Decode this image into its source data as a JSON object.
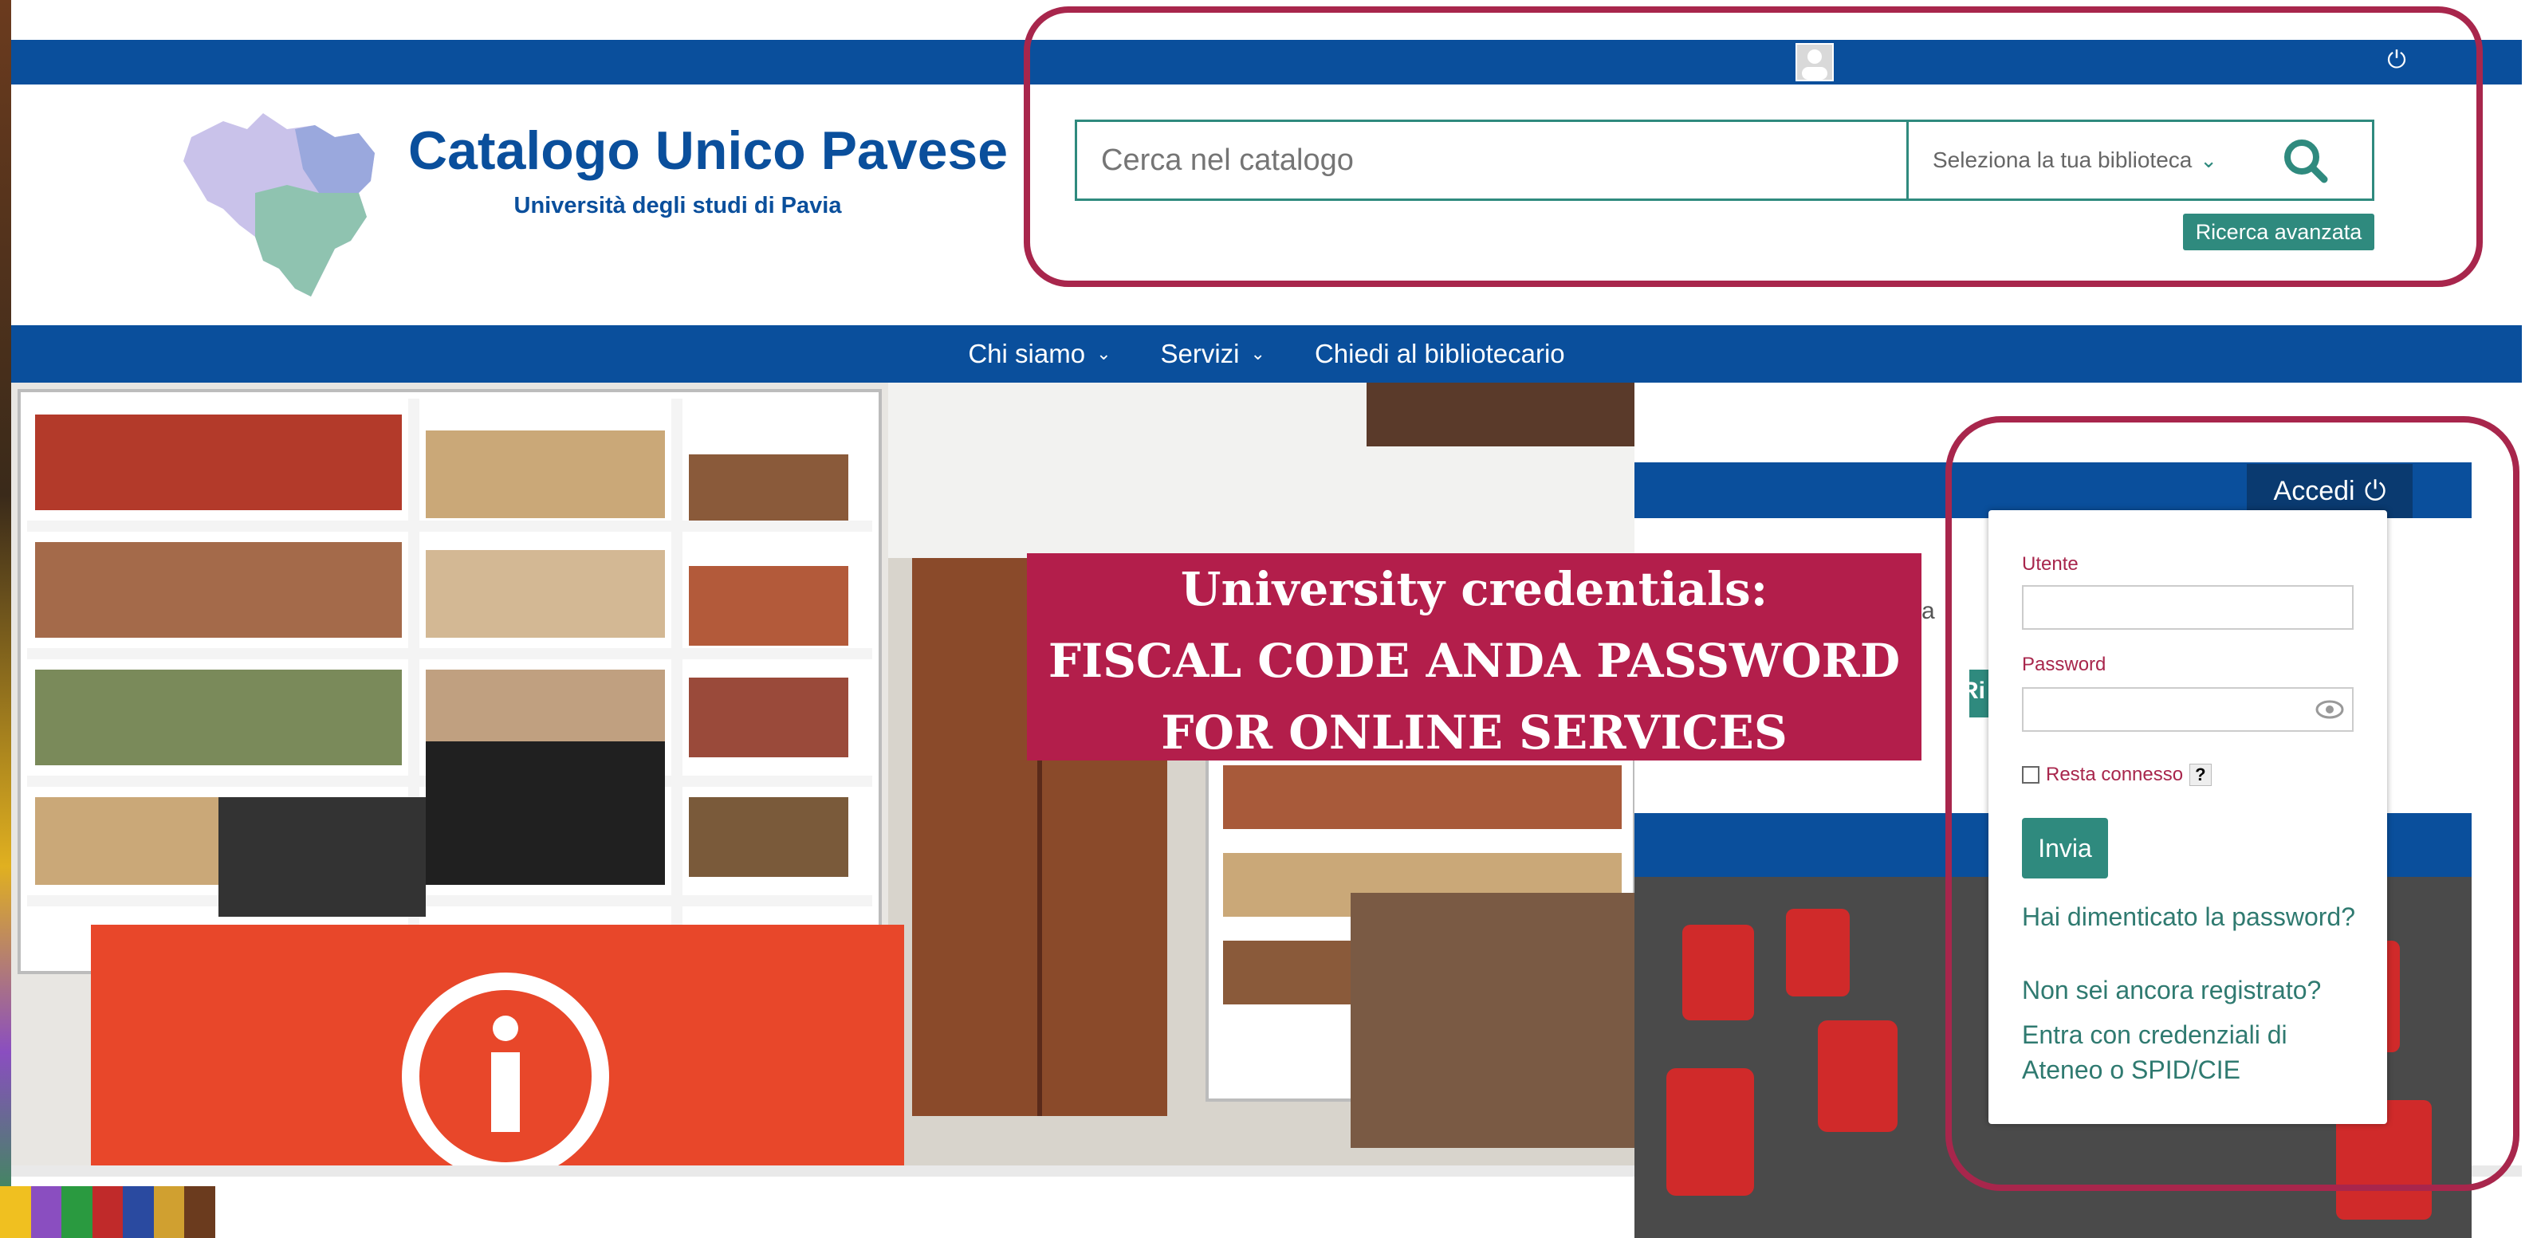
{
  "header": {
    "title": "Catalogo Unico Pavese",
    "subtitle": "Università degli studi di Pavia"
  },
  "search": {
    "placeholder": "Cerca nel catalogo",
    "library_select": "Seleziona la tua biblioteca",
    "advanced_label": "Ricerca avanzata"
  },
  "nav": {
    "items": [
      {
        "label": "Chi siamo",
        "has_dropdown": true
      },
      {
        "label": "Servizi",
        "has_dropdown": true
      },
      {
        "label": "Chiedi al bibliotecario",
        "has_dropdown": false
      }
    ]
  },
  "login": {
    "button_label": "Accedi",
    "user_label": "Utente",
    "password_label": "Password",
    "remember_label": "Resta connesso",
    "help_label": "?",
    "submit_label": "Invia",
    "forgot_password": "Hai dimenticato la password?",
    "not_registered": "Non sei ancora registrato?",
    "sso_login": "Entra con credenziali di Ateneo o SPID/CIE"
  },
  "banner": {
    "line1": "University credentials:",
    "line2": "FISCAL CODE ANDA PASSWORD",
    "line3": "FOR ONLINE SERVICES"
  },
  "partial_text": {
    "fragment_a": "a",
    "fragment_ri": "Ri"
  },
  "colors": {
    "brand_blue": "#0a4f9c",
    "teal": "#2f8a7e",
    "annotation": "#a8264c",
    "banner": "#b31e4b"
  },
  "icons": [
    "user-avatar-icon",
    "power-icon",
    "search-icon",
    "chevron-down-icon",
    "eye-icon",
    "info-icon"
  ]
}
